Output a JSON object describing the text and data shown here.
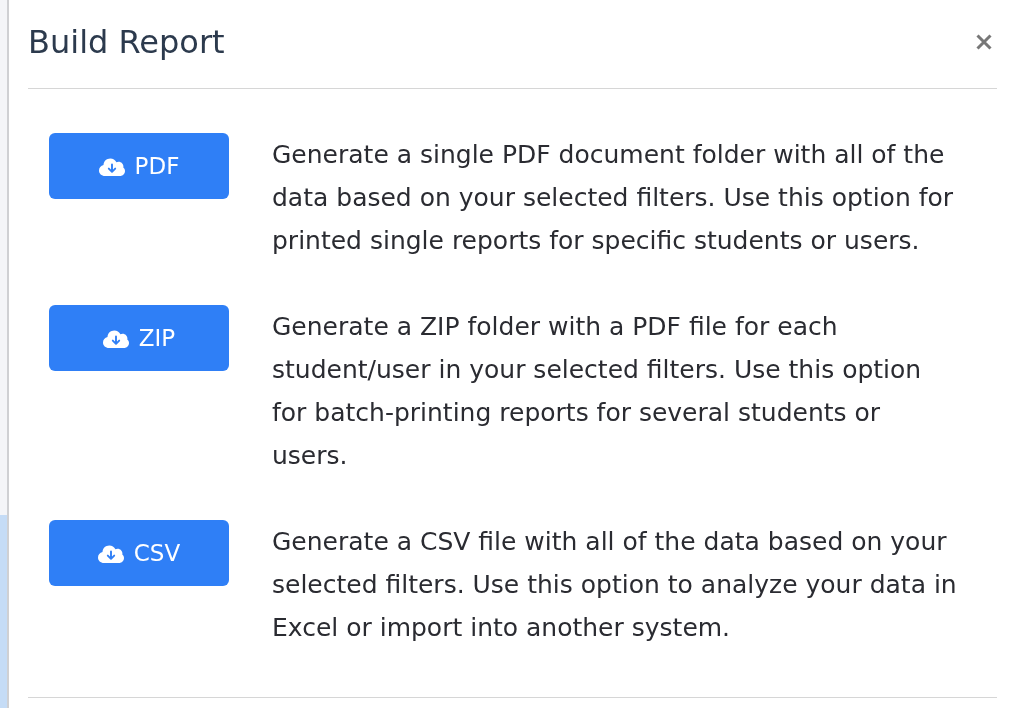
{
  "dialog": {
    "title": "Build Report",
    "options": [
      {
        "button": "PDF",
        "description": "Generate a single PDF document folder with all of the data based on your selected filters. Use this option for printed single reports for specific students or users."
      },
      {
        "button": "ZIP",
        "description": "Generate a ZIP folder with a PDF file for each student/user in your selected filters. Use this option for batch-printing reports for several students or users."
      },
      {
        "button": "CSV",
        "description": "Generate a CSV file with all of the data based on your selected filters. Use this option to analyze your data in Excel or import into another system."
      }
    ]
  }
}
